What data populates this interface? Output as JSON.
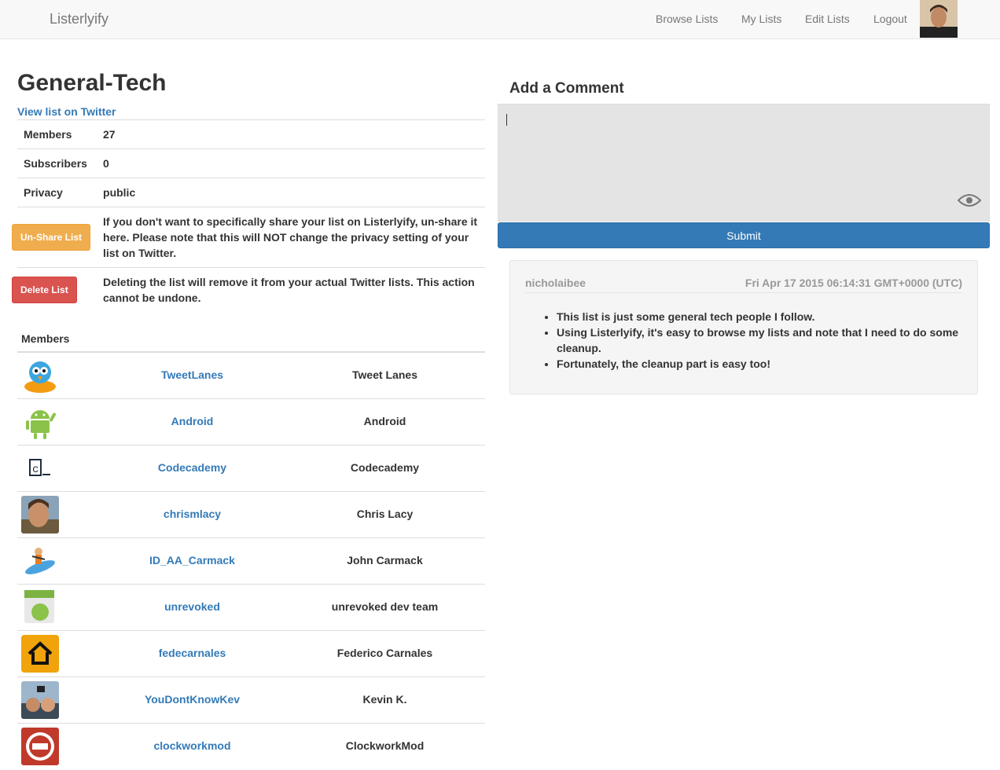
{
  "nav": {
    "brand": "Listerlyify",
    "links": [
      "Browse Lists",
      "My Lists",
      "Edit Lists",
      "Logout"
    ]
  },
  "list": {
    "title": "General-Tech",
    "twitter_link": "View list on Twitter",
    "members_label": "Members",
    "members_value": "27",
    "subscribers_label": "Subscribers",
    "subscribers_value": "0",
    "privacy_label": "Privacy",
    "privacy_value": "public",
    "unshare_button": "Un-Share List",
    "unshare_text": "If you don't want to specifically share your list on Listerlyify, un-share it here. Please note that this will NOT change the privacy setting of your list on Twitter.",
    "delete_button": "Delete List",
    "delete_text": "Deleting the list will remove it from your actual Twitter lists. This action cannot be undone."
  },
  "members": {
    "heading": "Members",
    "rows": [
      {
        "handle": "TweetLanes",
        "name": "Tweet Lanes"
      },
      {
        "handle": "Android",
        "name": "Android"
      },
      {
        "handle": "Codecademy",
        "name": "Codecademy"
      },
      {
        "handle": "chrismlacy",
        "name": "Chris Lacy"
      },
      {
        "handle": "ID_AA_Carmack",
        "name": "John Carmack"
      },
      {
        "handle": "unrevoked",
        "name": "unrevoked dev team"
      },
      {
        "handle": "fedecarnales",
        "name": "Federico Carnales"
      },
      {
        "handle": "YouDontKnowKev",
        "name": "Kevin K."
      },
      {
        "handle": "clockworkmod",
        "name": "ClockworkMod"
      }
    ]
  },
  "comment": {
    "heading": "Add a Comment",
    "submit": "Submit",
    "card": {
      "author": "nicholaibee",
      "timestamp": "Fri Apr 17 2015 06:14:31 GMT+0000 (UTC)",
      "bullets": [
        "This list is just some general tech people I follow.",
        "Using Listerlyify, it's easy to browse my lists and note that I need to do some cleanup.",
        "Fortunately, the cleanup part is easy too!"
      ]
    }
  },
  "colors": {
    "link": "#337ab7",
    "warning": "#f0ad4e",
    "danger": "#d9534f",
    "primary": "#337ab7"
  }
}
